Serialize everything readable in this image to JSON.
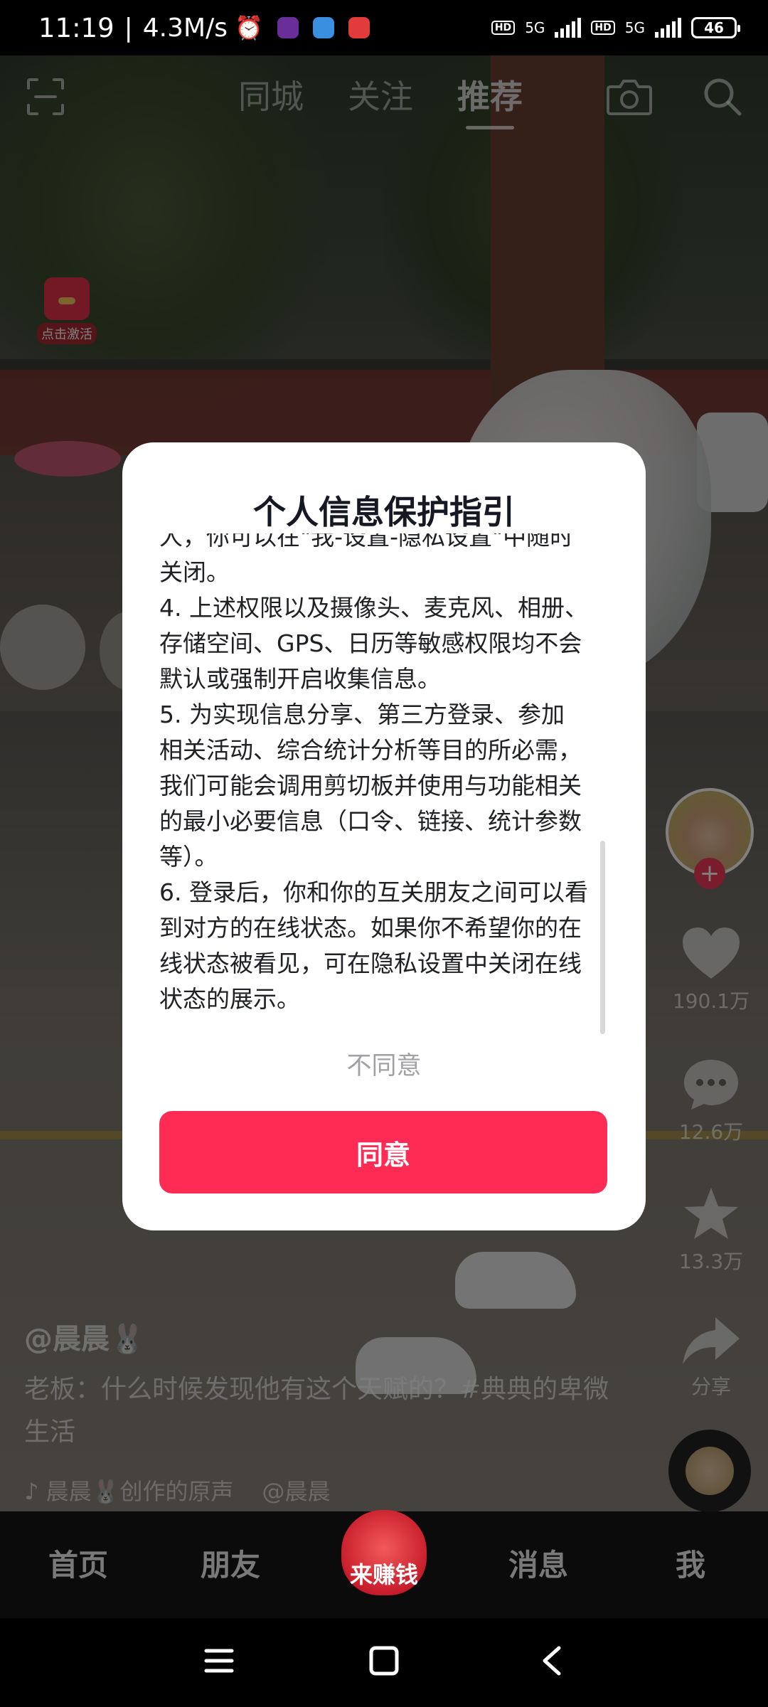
{
  "status_bar": {
    "time": "11:19",
    "separator": "|",
    "net_speed": "4.3M/s",
    "hd_label": "HD",
    "network_1": "5G",
    "network_2": "5G",
    "battery": "46"
  },
  "top_nav": {
    "tabs": [
      {
        "label": "同城",
        "active": false
      },
      {
        "label": "关注",
        "active": false
      },
      {
        "label": "推荐",
        "active": true
      }
    ]
  },
  "red_packet": {
    "label": "点击激活"
  },
  "right_rail": {
    "likes": "190.1万",
    "comments": "12.6万",
    "favorites": "13.3万",
    "share": "分享"
  },
  "caption": {
    "author": "@晨晨🐰",
    "description": "老板：什么时候发现他有这个天赋的？#典典的卑微生活",
    "music": "晨晨🐰创作的原声",
    "music_author": "@晨晨"
  },
  "bottom_nav": {
    "home": "首页",
    "friends": "朋友",
    "earn": "来赚钱",
    "messages": "消息",
    "me": "我"
  },
  "dialog": {
    "title": "个人信息保护指引",
    "lines": [
      "人，你可以在\"我-设置-隐私设置\"中随时",
      "关闭。",
      "4. 上述权限以及摄像头、麦克风、相册、",
      "存储空间、GPS、日历等敏感权限均不会",
      "默认或强制开启收集信息。",
      "5. 为实现信息分享、第三方登录、参加",
      "相关活动、综合统计分析等目的所必需，",
      "我们可能会调用剪切板并使用与功能相关",
      "的最小必要信息（口令、链接、统计参数",
      "等）。",
      "6. 登录后，你和你的互关朋友之间可以看",
      "到对方的在线状态。如果你不希望你的在",
      "线状态被看见，可在隐私设置中关闭在线",
      "状态的展示。"
    ],
    "disagree": "不同意",
    "agree": "同意"
  },
  "colors": {
    "accent": "#fe2c55",
    "dialog_bg": "#ffffff",
    "text": "#161823"
  }
}
